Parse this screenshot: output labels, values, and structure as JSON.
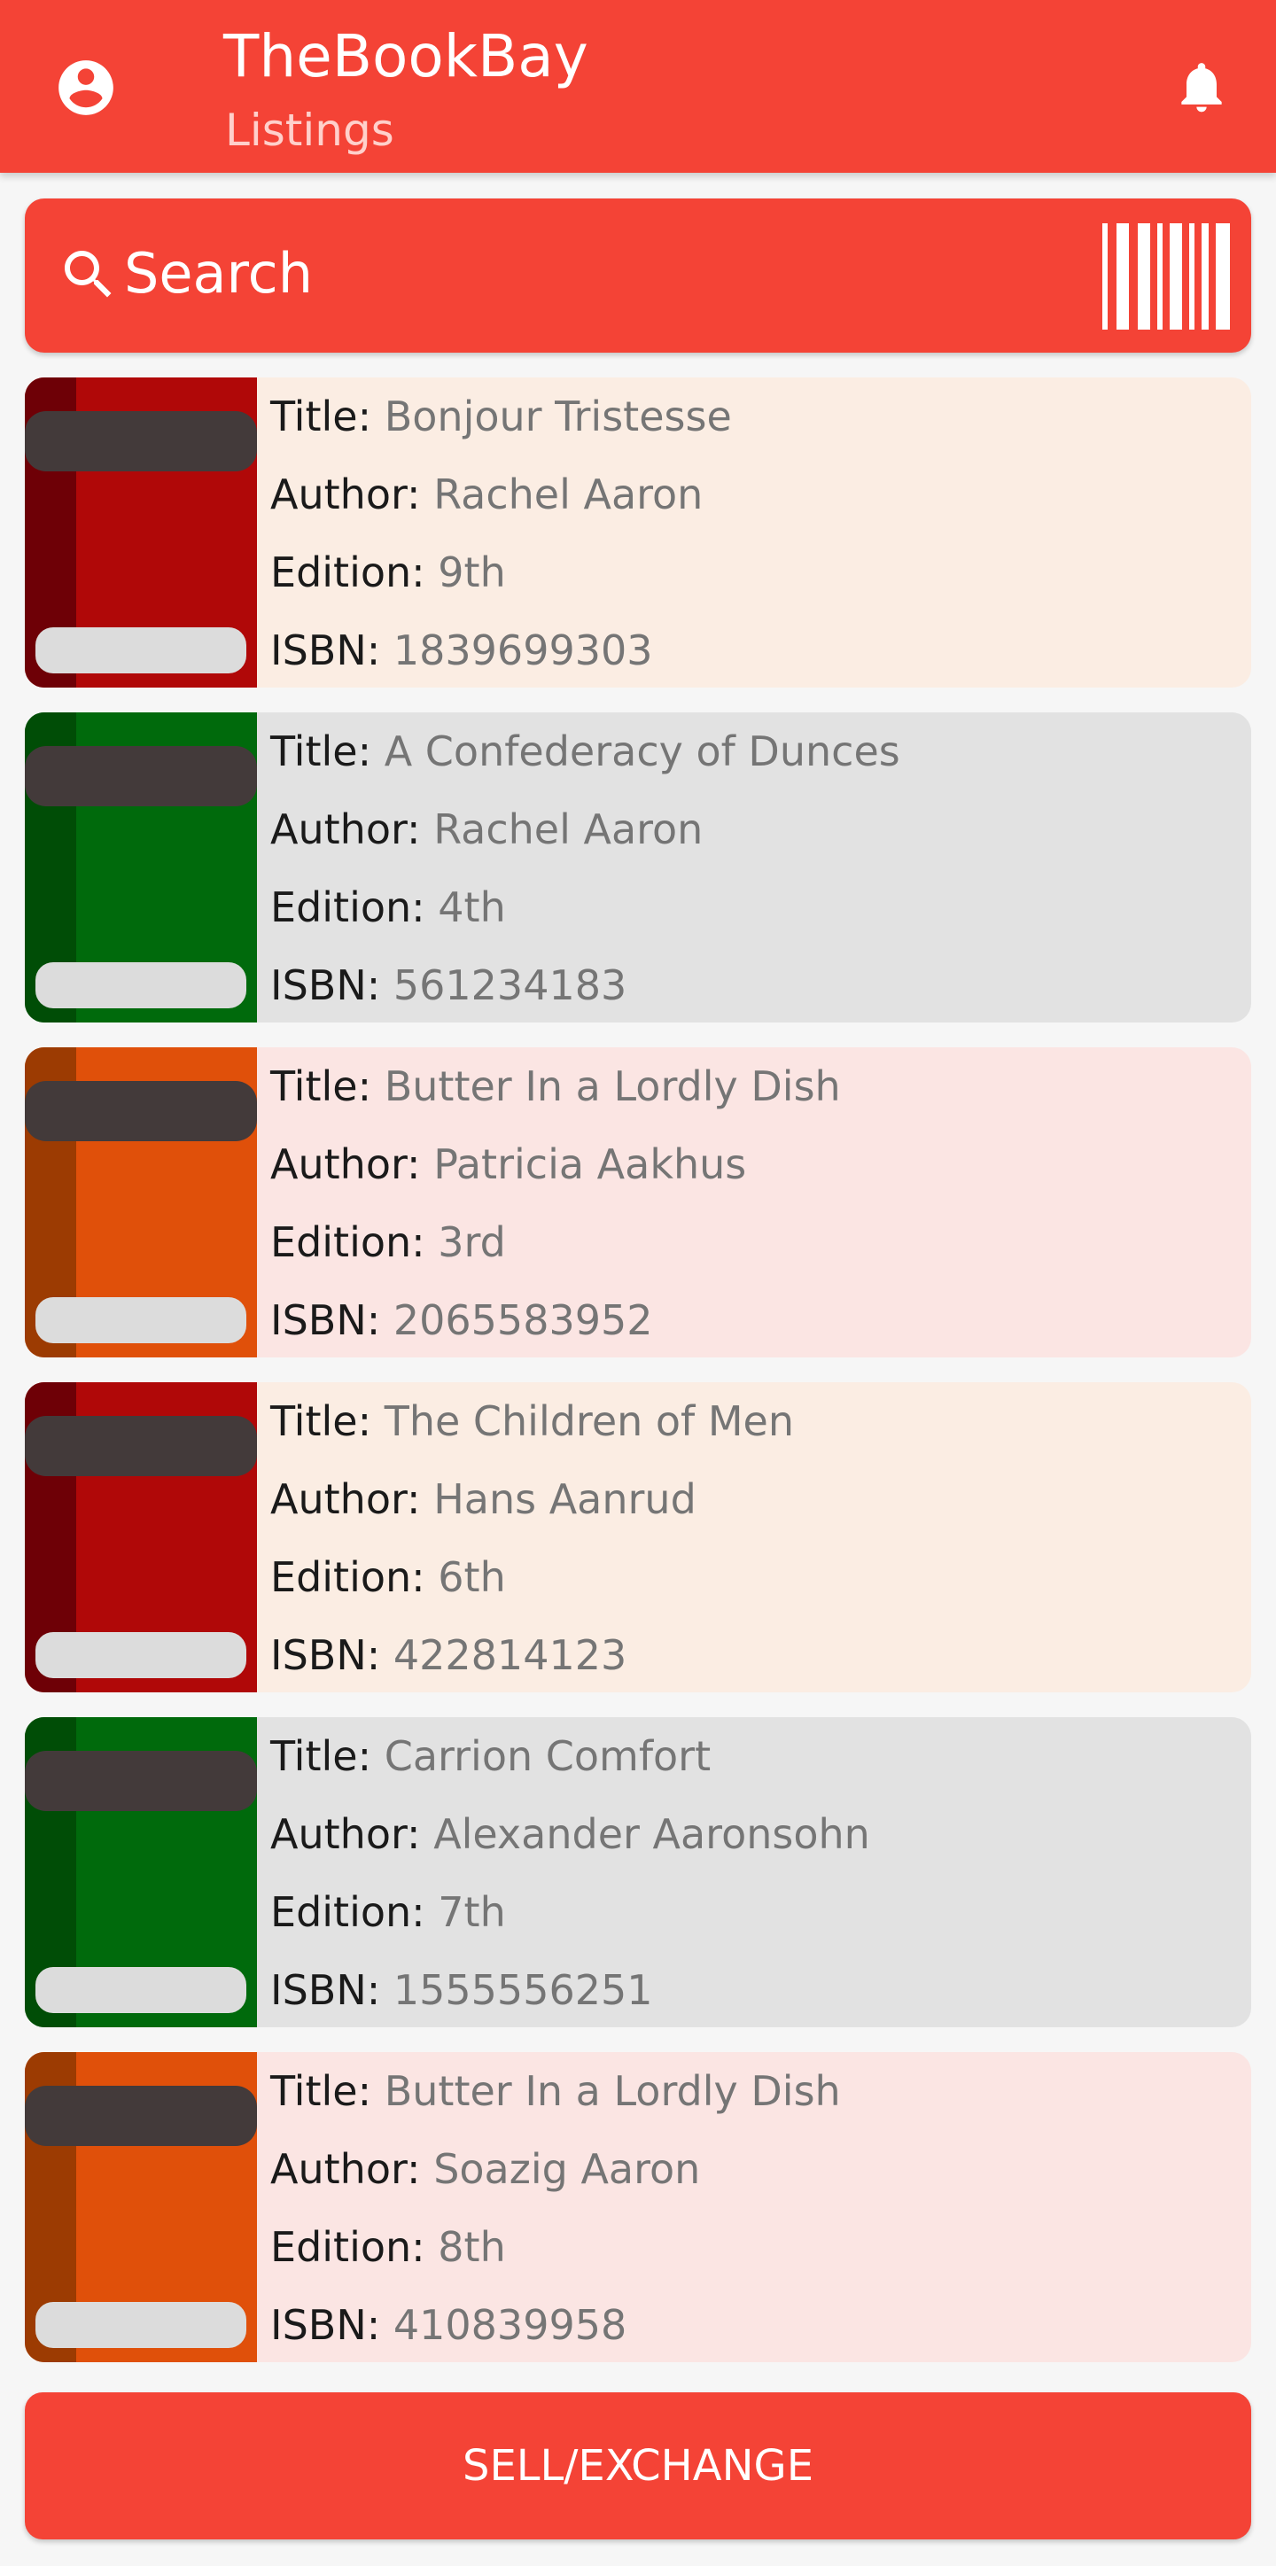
{
  "appbar": {
    "title": "TheBookBay",
    "subtitle": "Listings",
    "profile_icon": "account-circle-icon",
    "notification_icon": "bell-icon"
  },
  "search": {
    "label": "Search",
    "icon": "search-icon",
    "scan_icon": "barcode-icon"
  },
  "labels": {
    "title": "Title:",
    "author": "Author:",
    "edition": "Edition:",
    "isbn": "ISBN:"
  },
  "listings": [
    {
      "title": "Bonjour Tristesse",
      "author": "Rachel Aaron",
      "edition": "9th",
      "isbn": "1839699303",
      "book_color": "#b00808",
      "book_spine": "#6e0006",
      "card_color": "#fbede3"
    },
    {
      "title": "A Confederacy of Dunces",
      "author": "Rachel Aaron",
      "edition": "4th",
      "isbn": "561234183",
      "book_color": "#006a0c",
      "book_spine": "#004d06",
      "card_color": "#e2e2e2"
    },
    {
      "title": "Butter In a Lordly Dish",
      "author": "Patricia Aakhus",
      "edition": "3rd",
      "isbn": "2065583952",
      "book_color": "#e0500a",
      "book_spine": "#9c3b02",
      "card_color": "#fbe5e3"
    },
    {
      "title": "The Children of Men",
      "author": "Hans Aanrud",
      "edition": "6th",
      "isbn": "422814123",
      "book_color": "#b00808",
      "book_spine": "#6e0006",
      "card_color": "#fbede3"
    },
    {
      "title": "Carrion Comfort",
      "author": "Alexander Aaronsohn",
      "edition": "7th",
      "isbn": "1555556251",
      "book_color": "#006a0c",
      "book_spine": "#004d06",
      "card_color": "#e2e2e2"
    },
    {
      "title": "Butter In a Lordly Dish",
      "author": "Soazig Aaron",
      "edition": "8th",
      "isbn": "410839958",
      "book_color": "#e0500a",
      "book_spine": "#9c3b02",
      "card_color": "#fbe5e3"
    }
  ],
  "sell_button": {
    "label": "SELL/EXCHANGE"
  },
  "colors": {
    "primary": "#f44336"
  }
}
